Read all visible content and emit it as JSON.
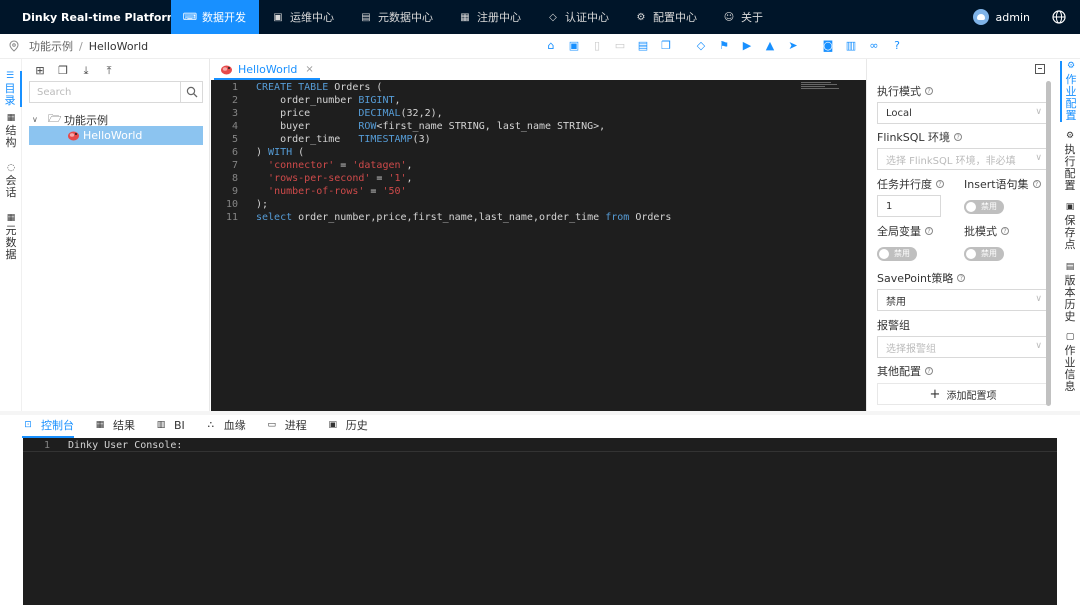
{
  "app": {
    "title": "Dinky Real-time Platform",
    "brand_color": "#001529",
    "accent": "#1890ff"
  },
  "nav": {
    "items": [
      {
        "label": "数据开发",
        "icon": "code-icon",
        "active": true
      },
      {
        "label": "运维中心",
        "icon": "monitor-icon"
      },
      {
        "label": "元数据中心",
        "icon": "database-icon"
      },
      {
        "label": "注册中心",
        "icon": "grid-icon"
      },
      {
        "label": "认证中心",
        "icon": "shield-icon"
      },
      {
        "label": "配置中心",
        "icon": "gear-icon"
      },
      {
        "label": "关于",
        "icon": "smile-icon"
      }
    ],
    "user": "admin"
  },
  "breadcrumb": {
    "parent": "功能示例",
    "separator": "/",
    "current": "HelloWorld"
  },
  "left_tabs": [
    "目录",
    "结构",
    "会话",
    "元数据"
  ],
  "file_panel": {
    "search_placeholder": "Search",
    "folder": "功能示例",
    "file": "HelloWorld"
  },
  "editor": {
    "tab_label": "HelloWorld",
    "close_glyph": "×",
    "lines": [
      {
        "n": "1",
        "html": "<span class=\"kw\">CREATE TABLE</span> Orders ("
      },
      {
        "n": "2",
        "html": "    order_number <span class=\"kw\">BIGINT</span>,"
      },
      {
        "n": "3",
        "html": "    price        <span class=\"kw\">DECIMAL</span>(32,2),"
      },
      {
        "n": "4",
        "html": "    buyer        <span class=\"kw\">ROW</span>&lt;first_name STRING, last_name STRING&gt;,"
      },
      {
        "n": "5",
        "html": "    order_time   <span class=\"kw\">TIMESTAMP</span>(3)"
      },
      {
        "n": "6",
        "html": ") <span class=\"kw\">WITH</span> ("
      },
      {
        "n": "7",
        "html": "  <span class=\"str\">'connector'</span> = <span class=\"str\">'datagen'</span>,"
      },
      {
        "n": "8",
        "html": "  <span class=\"str\">'rows-per-second'</span> = <span class=\"str\">'1'</span>,"
      },
      {
        "n": "9",
        "html": "  <span class=\"str\">'number-of-rows'</span> = <span class=\"str\">'50'</span>"
      },
      {
        "n": "10",
        "html": ");"
      },
      {
        "n": "11",
        "html": "<span class=\"kw\">select</span> order_number,price,first_name,last_name,order_time <span class=\"kw\">from</span> Orders"
      }
    ]
  },
  "config": {
    "exec_mode_label": "执行模式",
    "exec_mode_value": "Local",
    "flinksql_env_label": "FlinkSQL 环境",
    "flinksql_env_placeholder": "选择 FlinkSQL 环境，非必填",
    "parallelism_label": "任务并行度",
    "parallelism_value": "1",
    "insert_label": "Insert语句集",
    "insert_value": "禁用",
    "global_var_label": "全局变量",
    "global_var_value": "禁用",
    "batch_label": "批模式",
    "batch_value": "禁用",
    "savepoint_label": "SavePoint策略",
    "savepoint_value": "禁用",
    "alert_label": "报警组",
    "alert_placeholder": "选择报警组",
    "other_label": "其他配置",
    "add_config": "添加配置项"
  },
  "right_tabs": [
    "作业配置",
    "执行配置",
    "保存点",
    "版本历史",
    "作业信息"
  ],
  "bottom": {
    "tabs": [
      "控制台",
      "结果",
      "BI",
      "血缘",
      "进程",
      "历史"
    ],
    "console_lines": [
      {
        "n": "1",
        "text": "Dinky User Console:"
      }
    ]
  }
}
